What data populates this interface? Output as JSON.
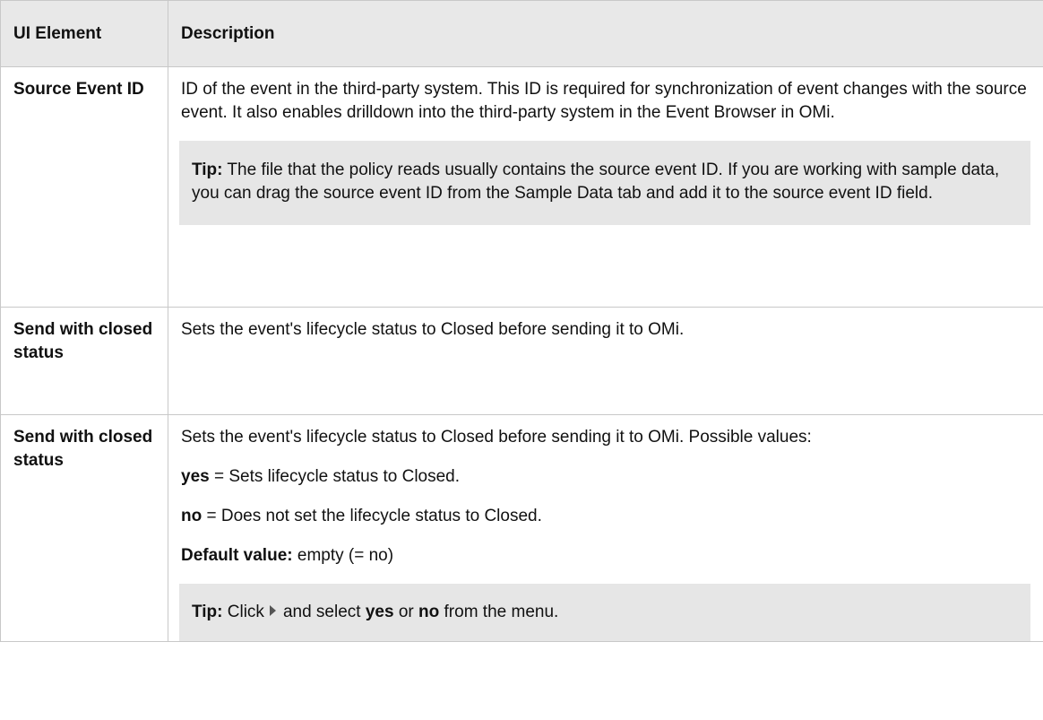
{
  "header": {
    "col_element": "UI Element",
    "col_description": "Description"
  },
  "rows": [
    {
      "element": "Source Event ID",
      "desc": "ID of the event in the third-party system. This ID is required for synchronization of event changes with the source event. It also enables drilldown into the third-party system in the Event Browser in OMi.",
      "tip_label": "Tip:",
      "tip_text": "The file that the policy reads usually contains the source event ID. If you are working with sample data, you can drag the source event ID from the Sample Data tab and add it to the source event ID field."
    },
    {
      "element": "Send with closed status",
      "desc": "Sets the event's lifecycle status to Closed before sending it to OMi."
    },
    {
      "element": "Send with closed status",
      "desc": "Sets the event's lifecycle status to Closed before sending it to OMi. Possible values:",
      "yes_label": "yes",
      "yes_text": "= Sets lifecycle status to Closed.",
      "no_label": "no",
      "no_text": "= Does not set the lifecycle status to Closed.",
      "default_label": "Default value:",
      "default_text": "empty (= no)",
      "tip_label": "Tip:",
      "tip_click": "Click",
      "tip_and_select": "and select",
      "tip_yes": "yes",
      "tip_or": "or",
      "tip_no": "no",
      "tip_end": "from the menu."
    }
  ]
}
